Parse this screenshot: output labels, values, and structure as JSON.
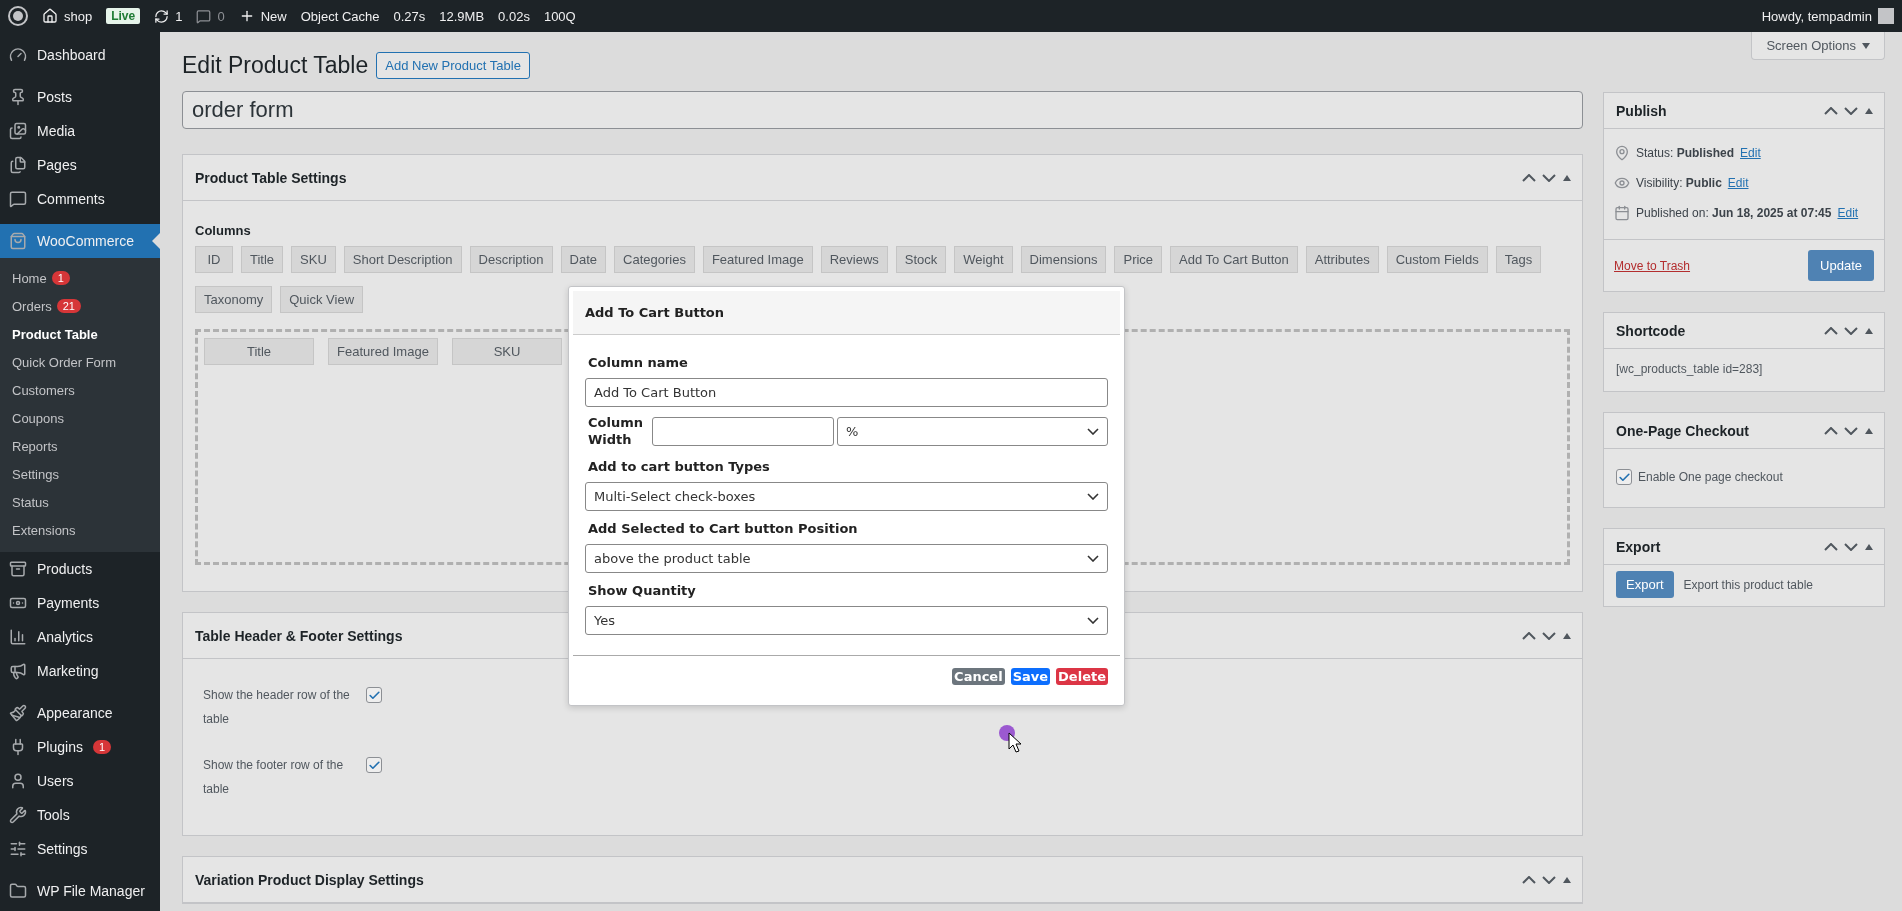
{
  "admin_bar": {
    "site": "shop",
    "badge": "Live",
    "updates": "1",
    "comments": "0",
    "new": "New",
    "cache": "Object Cache",
    "stats": [
      "0.27s",
      "12.9MB",
      "0.02s",
      "100Q"
    ],
    "greeting": "Howdy, tempadmin"
  },
  "sidebar": {
    "groups": [
      {
        "items": [
          {
            "label": "Dashboard",
            "selected": false
          }
        ]
      },
      {
        "items": [
          {
            "label": "Posts",
            "selected": false
          },
          {
            "label": "Media",
            "selected": false
          },
          {
            "label": "Pages",
            "selected": false
          },
          {
            "label": "Comments",
            "selected": false
          }
        ]
      },
      {
        "items": [
          {
            "label": "WooCommerce",
            "selected": true,
            "children": [
              {
                "label": "Home",
                "badge": "1",
                "selected": false
              },
              {
                "label": "Orders",
                "badge": "21",
                "selected": false
              },
              {
                "label": "Product Table",
                "selected": true
              },
              {
                "label": "Quick Order Form",
                "selected": false
              },
              {
                "label": "Customers",
                "selected": false
              },
              {
                "label": "Coupons",
                "selected": false
              },
              {
                "label": "Reports",
                "selected": false
              },
              {
                "label": "Settings",
                "selected": false
              },
              {
                "label": "Status",
                "selected": false
              },
              {
                "label": "Extensions",
                "selected": false
              }
            ]
          },
          {
            "label": "Products",
            "selected": false
          },
          {
            "label": "Payments",
            "selected": false
          },
          {
            "label": "Analytics",
            "selected": false
          },
          {
            "label": "Marketing",
            "selected": false
          }
        ]
      },
      {
        "items": [
          {
            "label": "Appearance",
            "selected": false
          },
          {
            "label": "Plugins",
            "badge": "1",
            "selected": false
          },
          {
            "label": "Users",
            "selected": false
          },
          {
            "label": "Tools",
            "selected": false
          },
          {
            "label": "Settings",
            "selected": false
          }
        ]
      },
      {
        "items": [
          {
            "label": "WP File Manager",
            "selected": false
          }
        ]
      }
    ]
  },
  "screen_options": "Screen Options",
  "page_title": "Edit Product Table",
  "add_new_button": "Add New Product Table",
  "title_field": {
    "value": "order form"
  },
  "settings_panel": {
    "title": "Product Table Settings",
    "columns_label": "Columns",
    "available_columns": [
      "ID",
      "Title",
      "SKU",
      "Short Description",
      "Description",
      "Date",
      "Categories",
      "Featured Image",
      "Reviews",
      "Stock",
      "Weight",
      "Dimensions",
      "Price",
      "Add To Cart Button",
      "Attributes",
      "Custom Fields",
      "Tags",
      "Taxonomy",
      "Quick View"
    ],
    "selected_columns": [
      "Title",
      "Featured Image",
      "SKU"
    ]
  },
  "header_footer_panel": {
    "title": "Table Header & Footer Settings",
    "options": [
      {
        "label": "Show the header row of the table",
        "checked": true
      },
      {
        "label": "Show the footer row of the table",
        "checked": true
      }
    ]
  },
  "variation_panel": {
    "title": "Variation Product Display Settings"
  },
  "modal": {
    "title": "Add To Cart Button",
    "fields": [
      {
        "kind": "text",
        "label": "Column name",
        "value": "Add To Cart Button"
      },
      {
        "kind": "width",
        "label": "Column Width",
        "unit": "%"
      },
      {
        "kind": "select",
        "label": "Add to cart button Types",
        "value": "Multi-Select check-boxes"
      },
      {
        "kind": "select",
        "label": "Add Selected to Cart button Position",
        "value": "above the product table"
      },
      {
        "kind": "select",
        "label": "Show Quantity",
        "value": "Yes"
      }
    ],
    "buttons": [
      {
        "label": "Cancel",
        "kind": "secondary"
      },
      {
        "label": "Save",
        "kind": "primary"
      },
      {
        "label": "Delete",
        "kind": "danger"
      }
    ]
  },
  "publish": {
    "title": "Publish",
    "rows": [
      {
        "text": "Status: **Published**",
        "link": "Edit"
      },
      {
        "text": "Visibility: **Public**",
        "link": "Edit"
      },
      {
        "text": "Published on: **Jun 18, 2025 at 07:45**",
        "link": "Edit"
      }
    ],
    "trash": "Move to Trash",
    "update": "Update"
  },
  "shortcode": {
    "title": "Shortcode",
    "text": "[wc_products_table id=283]"
  },
  "checkout": {
    "title": "One-Page Checkout",
    "option": {
      "label": "Enable One page checkout",
      "checked": true
    }
  },
  "export": {
    "title": "Export",
    "button": "Export",
    "text": "Export this product table"
  }
}
